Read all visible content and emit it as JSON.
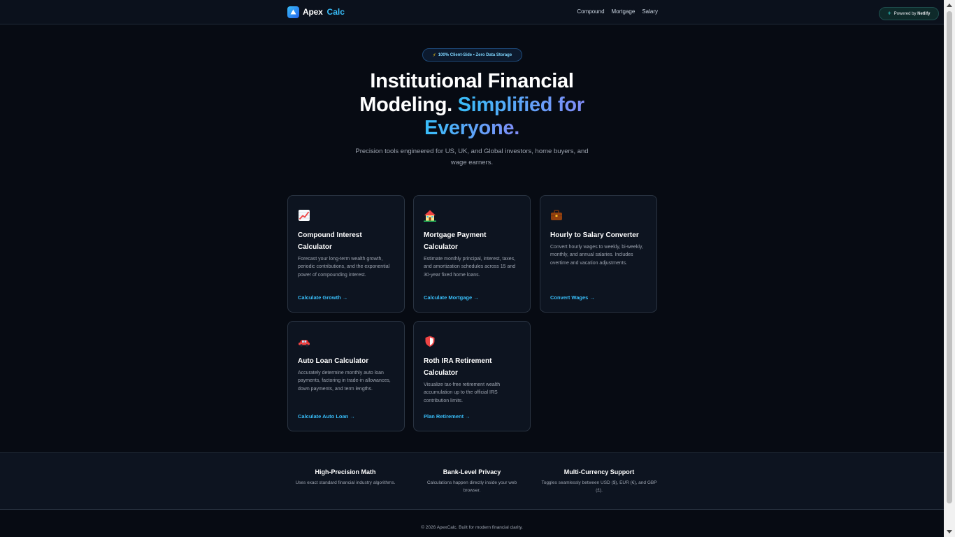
{
  "brand": {
    "name": "Apex",
    "accent": "Calc"
  },
  "nav": {
    "links": [
      "Compound",
      "Mortgage",
      "Salary"
    ]
  },
  "hero": {
    "badge_icon": "lightning-icon",
    "badge_text": "100% Client-Side • Zero Data Storage",
    "title_line1": "Institutional Financial",
    "title_line2_plain": "Modeling.",
    "title_line2_accent": "Simplified for",
    "title_line3_accent": "Everyone.",
    "subtitle": "Precision tools engineered for US, UK, and Global investors, home buyers, and wage earners."
  },
  "cards": [
    {
      "icon": "chart-trending-up-icon",
      "title": "Compound Interest Calculator",
      "description": "Forecast your long-term wealth growth, periodic contributions, and the exponential power of compounding interest.",
      "link": "Calculate Growth →"
    },
    {
      "icon": "house-icon",
      "title": "Mortgage Payment Calculator",
      "description": "Estimate monthly principal, interest, taxes, and amortization schedules across 15 and 30-year fixed home loans.",
      "link": "Calculate Mortgage →"
    },
    {
      "icon": "briefcase-icon",
      "title": "Hourly to Salary Converter",
      "description": "Convert hourly wages to weekly, bi-weekly, monthly, and annual salaries. Includes overtime and vacation adjustments.",
      "link": "Convert Wages →"
    },
    {
      "icon": "car-icon",
      "title": "Auto Loan Calculator",
      "description": "Accurately determine monthly auto loan payments, factoring in trade-in allowances, down payments, and term lengths.",
      "link": "Calculate Auto Loan →"
    },
    {
      "icon": "shield-icon",
      "title": "Roth IRA Retirement Calculator",
      "description": "Visualize tax-free retirement wealth accumulation up to the official IRS contribution limits.",
      "link": "Plan Retirement →"
    }
  ],
  "features": [
    {
      "title": "High-Precision Math",
      "description": "Uses exact standard financial industry algorithms."
    },
    {
      "title": "Bank-Level Privacy",
      "description": "Calculations happen directly inside your web browser."
    },
    {
      "title": "Multi-Currency Support",
      "description": "Toggles seamlessly between USD ($), EUR (€), and GBP (£)."
    }
  ],
  "footer": {
    "copyright": "© 2026 ApexCalc. Built for modern financial clarity.",
    "netlify_prefix": "Powered by",
    "netlify_brand": "Netlify"
  },
  "colors": {
    "background": "#070b13",
    "accent": "#38bdf8",
    "gradient_end": "#818cf8",
    "card_bg": "#0d1420",
    "card_border": "#2a3442"
  }
}
